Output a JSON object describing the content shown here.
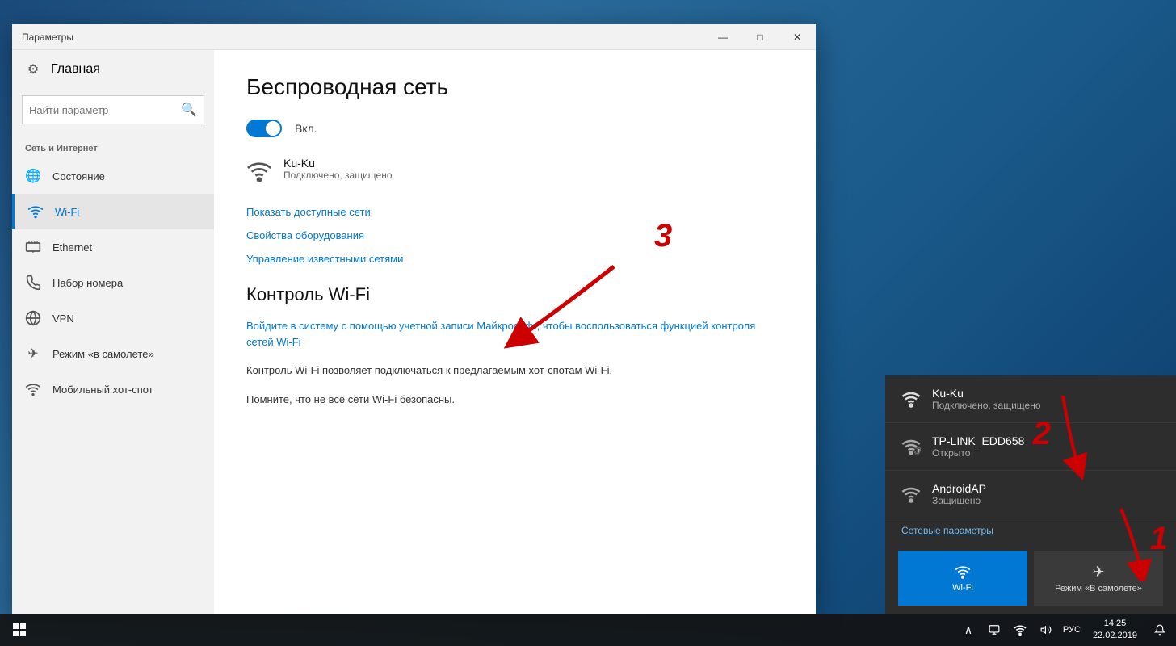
{
  "window": {
    "title": "Параметры",
    "controls": {
      "minimize": "—",
      "maximize": "□",
      "close": "✕"
    }
  },
  "sidebar": {
    "home_label": "Главная",
    "search_placeholder": "Найти параметр",
    "section_label": "Сеть и Интернет",
    "items": [
      {
        "id": "status",
        "label": "Состояние",
        "icon": "🌐"
      },
      {
        "id": "wifi",
        "label": "Wi-Fi",
        "icon": "📶",
        "active": true
      },
      {
        "id": "ethernet",
        "label": "Ethernet",
        "icon": "🖥"
      },
      {
        "id": "dialup",
        "label": "Набор номера",
        "icon": "📞"
      },
      {
        "id": "vpn",
        "label": "VPN",
        "icon": "⚙"
      },
      {
        "id": "airplane",
        "label": "Режим «в самолете»",
        "icon": "✈"
      },
      {
        "id": "hotspot",
        "label": "Мобильный хот-спот",
        "icon": "📡"
      }
    ]
  },
  "main": {
    "page_title": "Беспроводная сеть",
    "toggle_label": "Вкл.",
    "connected_network": {
      "name": "Ku-Ku",
      "status": "Подключено, защищено"
    },
    "links": {
      "show_networks": "Показать доступные сети",
      "hardware_props": "Свойства оборудования",
      "manage_networks": "Управление известными сетями"
    },
    "wifi_control_title": "Контроль Wi-Fi",
    "wifi_control_link": "Войдите в систему с помощью учетной записи Майкрософт, чтобы воспользоваться функцией контроля сетей Wi-Fi",
    "description1": "Контроль Wi-Fi позволяет подключаться к предлагаемым хот-спотам Wi-Fi.",
    "description2": "Помните, что не все сети Wi-Fi безопасны."
  },
  "flyout": {
    "networks": [
      {
        "name": "Ku-Ku",
        "status": "Подключено, защищено",
        "connected": true
      },
      {
        "name": "TP-LINK_EDD658",
        "status": "Открыто",
        "connected": false,
        "shield": true
      },
      {
        "name": "AndroidAP",
        "status": "Защищено",
        "connected": false
      }
    ],
    "network_settings_label": "Сетевые параметры",
    "actions": [
      {
        "label": "Wi-Fi",
        "active": true
      },
      {
        "label": "Режим «В самолете»",
        "active": false
      }
    ]
  },
  "taskbar": {
    "time": "14:25",
    "date": "22.02.2019",
    "language": "РУС"
  },
  "numbers": {
    "n1": "1",
    "n2": "2",
    "n3": "3"
  }
}
